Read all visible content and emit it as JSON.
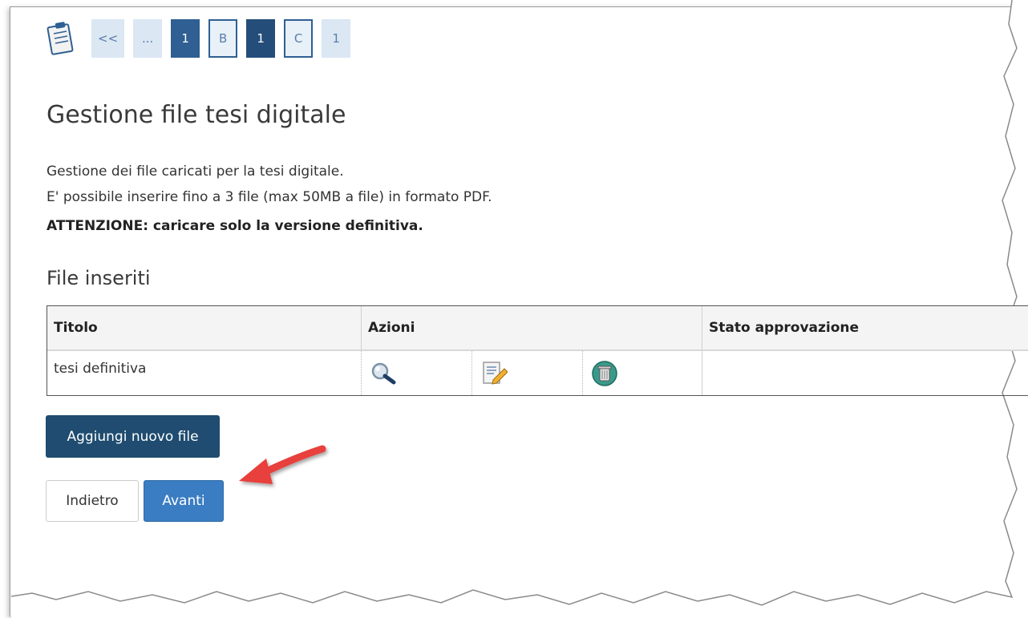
{
  "breadcrumb": {
    "items": [
      {
        "label": "<<",
        "style": "light"
      },
      {
        "label": "...",
        "style": "light"
      },
      {
        "label": "1",
        "style": "dark"
      },
      {
        "label": "B",
        "style": "outline"
      },
      {
        "label": "1",
        "style": "darker"
      },
      {
        "label": "C",
        "style": "outline"
      },
      {
        "label": "1",
        "style": "light"
      }
    ]
  },
  "page": {
    "title": "Gestione file tesi digitale",
    "desc_line1": "Gestione dei file caricati per la tesi digitale.",
    "desc_line2": "E' possibile inserire fino a 3 file (max 50MB a file) in formato PDF.",
    "warning": "ATTENZIONE: caricare solo la versione definitiva."
  },
  "files": {
    "section_title": "File inseriti",
    "headers": {
      "title": "Titolo",
      "actions": "Azioni",
      "status": "Stato approvazione"
    },
    "rows": [
      {
        "title": "tesi definitiva",
        "status": "",
        "actions": [
          "magnifier-icon",
          "edit-icon",
          "trash-icon"
        ]
      }
    ]
  },
  "buttons": {
    "add": "Aggiungi nuovo file",
    "back": "Indietro",
    "next": "Avanti"
  },
  "colors": {
    "brand_dark": "#1f4c70",
    "primary": "#3a7dc2",
    "annotation_arrow": "#e8413c"
  }
}
